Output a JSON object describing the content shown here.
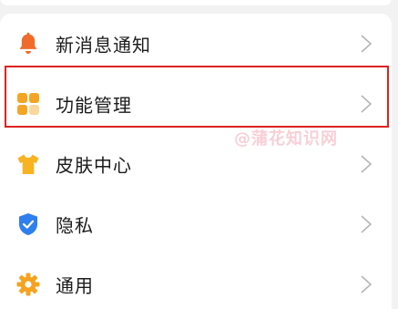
{
  "menu": {
    "items": [
      {
        "label": "新消息通知",
        "icon": "bell-icon"
      },
      {
        "label": "功能管理",
        "icon": "grid-icon"
      },
      {
        "label": "皮肤中心",
        "icon": "tshirt-icon"
      },
      {
        "label": "隐私",
        "icon": "shield-icon"
      },
      {
        "label": "通用",
        "icon": "gear-icon"
      }
    ]
  },
  "watermark": {
    "text": "@蒲花知识网"
  },
  "colors": {
    "bell": "#f06a2a",
    "grid": "#f5a524",
    "grid_light": "#fbd7a0",
    "tshirt": "#f7b321",
    "shield": "#2f7ff0",
    "gear": "#f5a31f",
    "highlight": "#dc2222",
    "chevron": "#b5b5b5"
  }
}
